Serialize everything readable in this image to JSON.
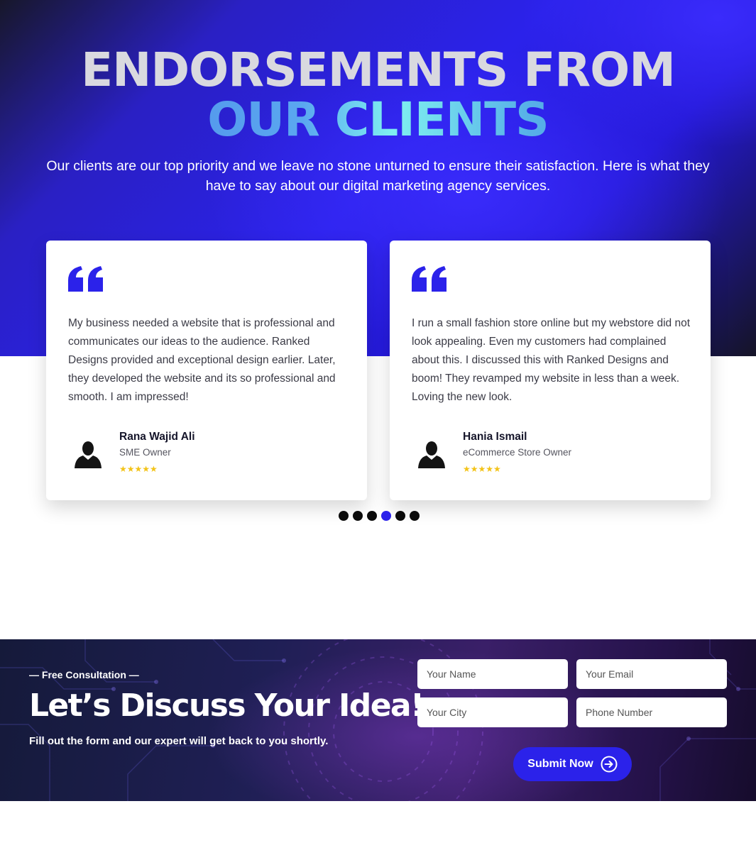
{
  "hero": {
    "title_line1": "ENDORSEMENTS FROM",
    "title_line2": "OUR CLIENTS",
    "subtitle": "Our clients are our top priority and we leave no stone unturned to ensure their satisfaction. Here is what they have to say about our digital marketing agency services."
  },
  "testimonials": [
    {
      "icon": "quote-icon",
      "text": "My business needed a website that is professional and communicates our ideas to the audience. Ranked Designs provided and exceptional design earlier. Later, they developed the website and its so professional and smooth. I am impressed!",
      "name": "Rana Wajid Ali",
      "role": "SME Owner",
      "stars": "★★★★★",
      "rating": 5
    },
    {
      "icon": "quote-icon",
      "text": "I run a small fashion store online but my webstore did not look appealing. Even my customers had complained about this. I discussed this with Ranked Designs and boom! They revamped my website in less than a week. Loving the new look.",
      "name": "Hania Ismail",
      "role": "eCommerce Store Owner",
      "stars": "★★★★★",
      "rating": 5
    }
  ],
  "carousel": {
    "total_slides": 6,
    "active_slide": 4
  },
  "consultation": {
    "eyebrow": "— Free Consultation —",
    "title": "Let’s Discuss Your Idea!",
    "subtitle": "Fill out the form and our expert will get back to you shortly.",
    "fields": {
      "name_placeholder": "Your Name",
      "email_placeholder": "Your Email",
      "city_placeholder": "Your City",
      "phone_placeholder": "Phone Number"
    },
    "submit_label": "Submit Now",
    "submit_icon": "arrow-right-circle-icon"
  },
  "colors": {
    "accent": "#2b22ea",
    "star": "#f3c318",
    "title_light": "#d9d9df",
    "title_gradient_start": "#4a82e6",
    "title_gradient_mid": "#7ff0f0"
  }
}
